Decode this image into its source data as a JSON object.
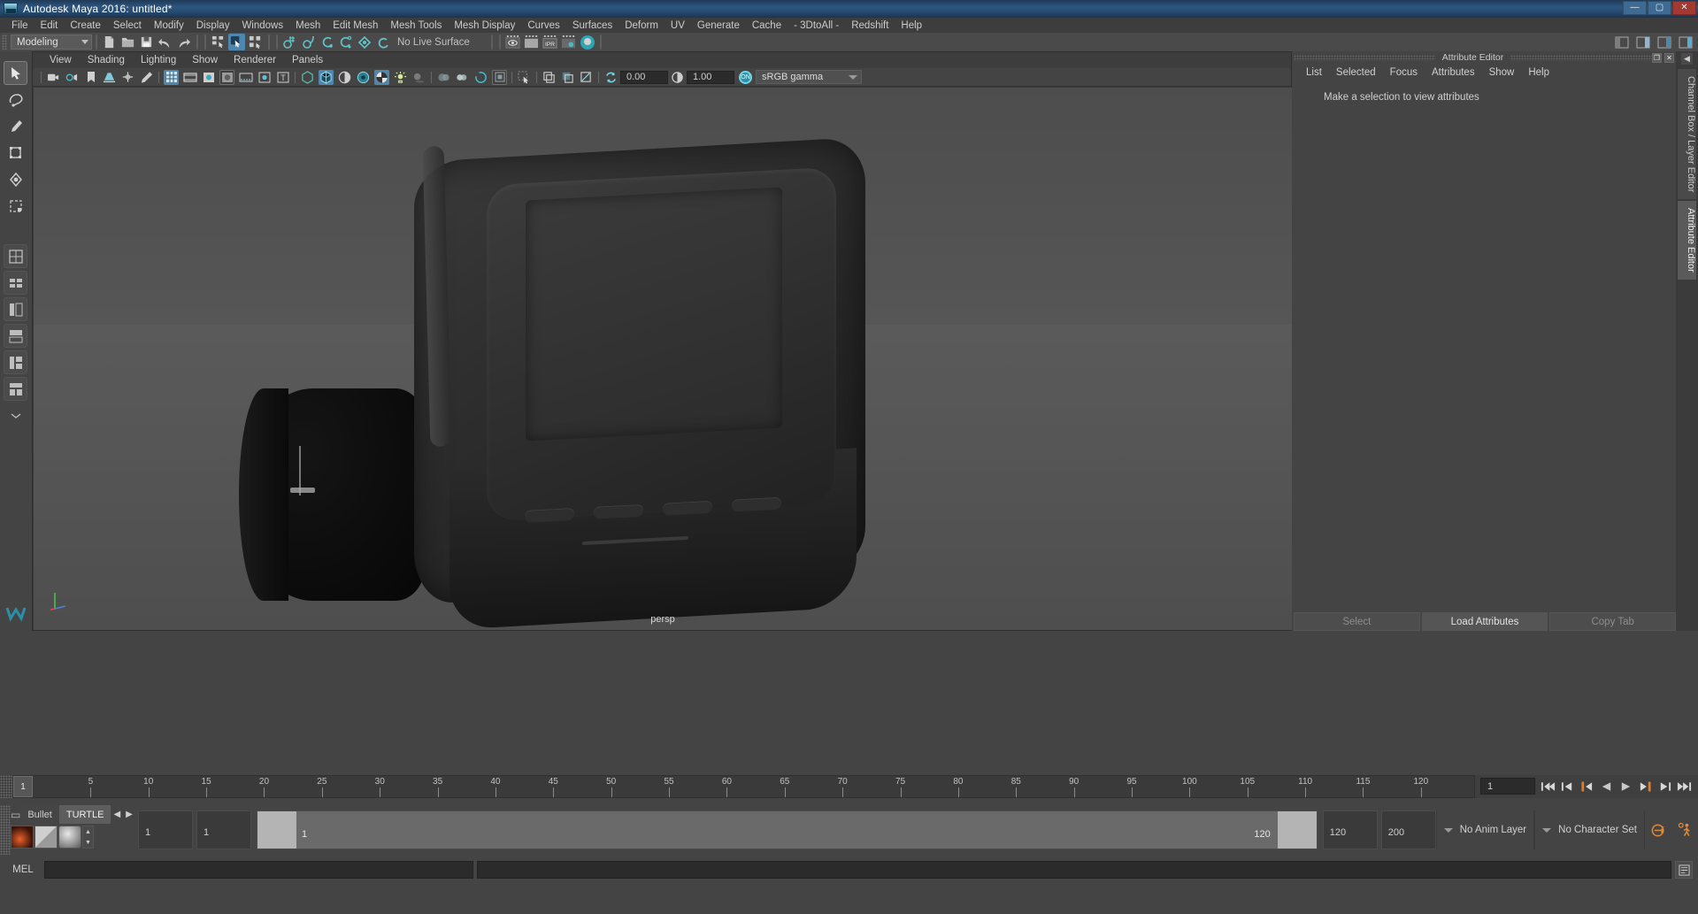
{
  "window": {
    "title": "Autodesk Maya 2016: untitled*",
    "controls": {
      "minimize": "—",
      "maximize": "▢",
      "close": "✕"
    }
  },
  "menubar": {
    "items": [
      "File",
      "Edit",
      "Create",
      "Select",
      "Modify",
      "Display",
      "Windows",
      "Mesh",
      "Edit Mesh",
      "Mesh Tools",
      "Mesh Display",
      "Curves",
      "Surfaces",
      "Deform",
      "UV",
      "Generate",
      "Cache",
      "- 3DtoAll -",
      "Redshift",
      "Help"
    ]
  },
  "statusbar": {
    "mode": "Modeling",
    "live_surface": "No Live Surface",
    "ipr_label": "IPR"
  },
  "viewport": {
    "menu": [
      "View",
      "Shading",
      "Lighting",
      "Show",
      "Renderer",
      "Panels"
    ],
    "exposure_value": "0.00",
    "gamma_value": "1.00",
    "color_profile": "sRGB gamma",
    "on_badge": "ON",
    "camera_label": "persp"
  },
  "attribute_editor": {
    "panel_title": "Attribute Editor",
    "menu": [
      "List",
      "Selected",
      "Focus",
      "Attributes",
      "Show",
      "Help"
    ],
    "message": "Make a selection to view attributes",
    "buttons": [
      "Select",
      "Load Attributes",
      "Copy Tab"
    ],
    "active_button": "Load Attributes"
  },
  "right_tabs": {
    "items": [
      "Channel Box / Layer Editor",
      "Attribute Editor"
    ],
    "selected": "Attribute Editor"
  },
  "timeline": {
    "ticks": [
      5,
      10,
      15,
      20,
      25,
      30,
      35,
      40,
      45,
      50,
      55,
      60,
      65,
      70,
      75,
      80,
      85,
      90,
      95,
      100,
      105,
      110,
      115,
      120
    ],
    "current_frame": "1",
    "end_label": "120",
    "frame_field": "1",
    "playback_buttons": [
      "go-to-start",
      "step-back-key",
      "step-back-frame",
      "play-backwards",
      "play-forwards",
      "step-forward-frame",
      "step-forward-key",
      "go-to-end"
    ]
  },
  "range_slider": {
    "shelf_tabs": [
      "Bullet",
      "TURTLE"
    ],
    "shelf_selected": "TURTLE",
    "anim_start": "1",
    "range_start": "1",
    "bar_start_label": "1",
    "bar_end_label": "120",
    "range_end": "120",
    "anim_end": "200",
    "anim_layer": "No Anim Layer",
    "character_set": "No Character Set"
  },
  "command_line": {
    "label": "MEL",
    "input_value": "",
    "output_value": ""
  },
  "colors": {
    "accent_blue": "#4f86ad",
    "title_blue": "#2d5680",
    "panel_bg": "#444444",
    "field_bg": "#2b2b2b",
    "teal": "#4bb8c8",
    "orange": "#e07b2a"
  }
}
